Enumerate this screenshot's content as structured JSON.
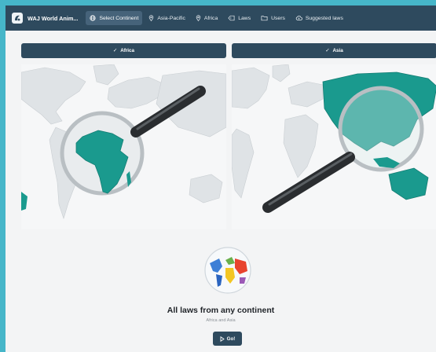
{
  "app": {
    "title": "WAJ World Anim..."
  },
  "nav": {
    "items": [
      {
        "label": "Select Continent",
        "icon": "globe-icon",
        "active": true
      },
      {
        "label": "Asia-Pacific",
        "icon": "map-pin-icon"
      },
      {
        "label": "Africa",
        "icon": "map-pin-icon"
      },
      {
        "label": "Laws",
        "icon": "tag-icon"
      },
      {
        "label": "Users",
        "icon": "folder-icon"
      },
      {
        "label": "Suggested laws",
        "icon": "cloud-upload-icon"
      }
    ]
  },
  "continents": {
    "africa_label": "Africa",
    "asia_label": "Asia"
  },
  "summary": {
    "headline": "All laws from any continent",
    "subtitle": "Africa and Asia",
    "go_label": "Go!"
  },
  "colors": {
    "brand": "#2e4a5e",
    "highlight": "#1a9a8e",
    "land": "#dde1e4",
    "accent_frame": "#46b6c9"
  }
}
